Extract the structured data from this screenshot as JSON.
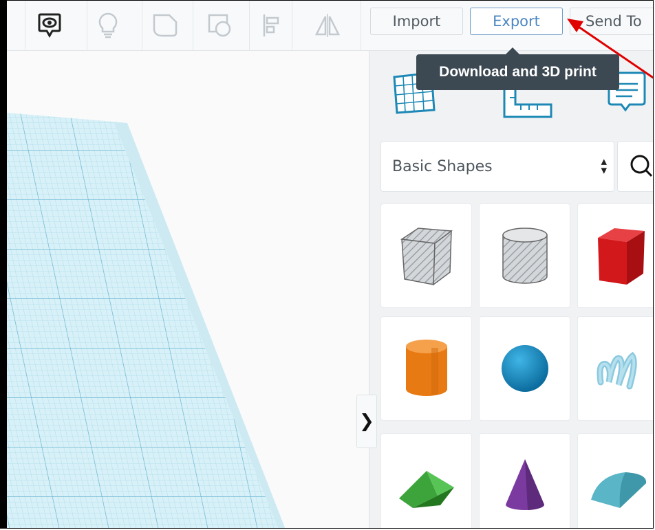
{
  "toolbar": {
    "import_label": "Import",
    "export_label": "Export",
    "send_to_label": "Send To",
    "icons": [
      "view-icon",
      "lightbulb-icon",
      "shape-icon",
      "group-icon",
      "align-icon",
      "mirror-icon"
    ]
  },
  "tooltip": {
    "text": "Download and 3D print"
  },
  "panel": {
    "view_icons": [
      "workplane-icon",
      "ruler-icon",
      "notes-icon"
    ],
    "category": "Basic Shapes",
    "shapes": [
      "box-hole",
      "cylinder-hole",
      "box",
      "cylinder",
      "sphere",
      "scribble",
      "roof",
      "cone",
      "round-roof"
    ]
  },
  "colors": {
    "accent": "#4a86c0",
    "annotation_arrow": "#e00000",
    "grid": "#9fd7ea",
    "box": "#d3181b",
    "cylinder": "#e87a14",
    "sphere": "#1288c4",
    "roof": "#3ca43a",
    "cone": "#7b3aa0",
    "round_roof": "#5ab5c6"
  }
}
